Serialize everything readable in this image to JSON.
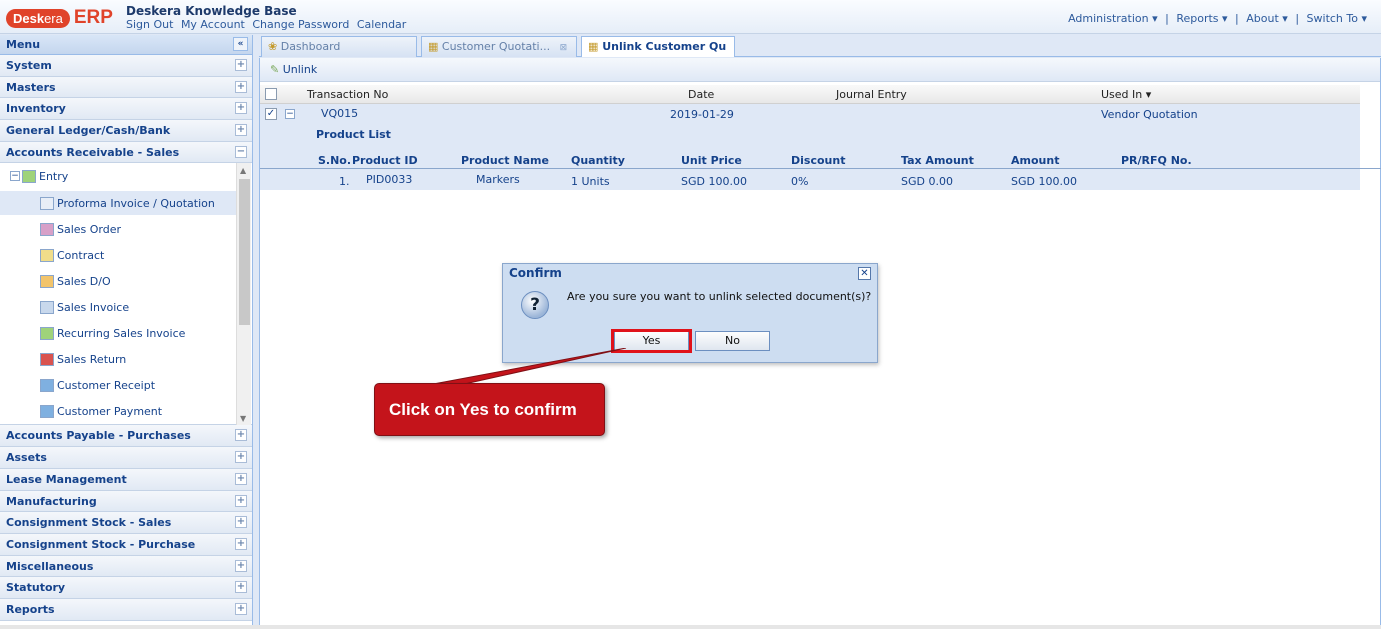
{
  "header": {
    "logo_pill": "Desk",
    "logo_pill_rest": "era",
    "logo_erp": "ERP",
    "kb_title": "Deskera Knowledge Base",
    "links": [
      "Sign Out",
      "My Account",
      "Change Password",
      "Calendar"
    ],
    "nav": [
      "Administration ▾",
      "|",
      "Reports ▾",
      "|",
      "About ▾",
      "|",
      "Switch To ▾"
    ]
  },
  "menu": {
    "title": "Menu",
    "collapse_icon": "«",
    "sections_top": [
      "System",
      "Masters",
      "Inventory",
      "General Ledger/Cash/Bank",
      "Accounts Receivable - Sales"
    ],
    "tree": {
      "root": "Entry",
      "items": [
        "Proforma Invoice / Quotation",
        "Sales Order",
        "Contract",
        "Sales D/O",
        "Sales Invoice",
        "Recurring Sales Invoice",
        "Sales Return",
        "Customer Receipt",
        "Customer Payment"
      ]
    },
    "sections_bottom": [
      "Accounts Payable - Purchases",
      "Assets",
      "Lease Management",
      "Manufacturing",
      "Consignment Stock - Sales",
      "Consignment Stock - Purchase",
      "Miscellaneous",
      "Statutory",
      "Reports"
    ]
  },
  "tabs": [
    {
      "label": "Dashboard"
    },
    {
      "label": "Customer Quotati..."
    },
    {
      "label": "Unlink Customer Qu"
    }
  ],
  "toolbar": {
    "unlink": "Unlink"
  },
  "grid": {
    "headers": [
      "Transaction No",
      "Date",
      "Journal Entry",
      "Used In ▾"
    ],
    "row": {
      "transaction_no": "VQ015",
      "date": "2019-01-29",
      "journal_entry": "",
      "used_in": "Vendor Quotation"
    },
    "product_list_label": "Product List",
    "sub_headers": [
      "S.No.",
      "Product ID",
      "Product Name",
      "Quantity",
      "Unit Price",
      "Discount",
      "Tax Amount",
      "Amount",
      "PR/RFQ No."
    ],
    "sub_row": [
      "1.",
      "PID0033",
      "Markers",
      "1 Units",
      "SGD 100.00",
      "0%",
      "SGD 0.00",
      "SGD 100.00",
      ""
    ]
  },
  "dialog": {
    "title": "Confirm",
    "close": "✕",
    "icon": "?",
    "message": "Are you sure you want to unlink selected document(s)?",
    "yes": "Yes",
    "no": "No"
  },
  "callout": {
    "text": "Click on Yes to confirm"
  },
  "colors": {
    "accent_red": "#c4141b",
    "panel_blue": "#dfe8f6",
    "text_blue": "#15428b"
  }
}
